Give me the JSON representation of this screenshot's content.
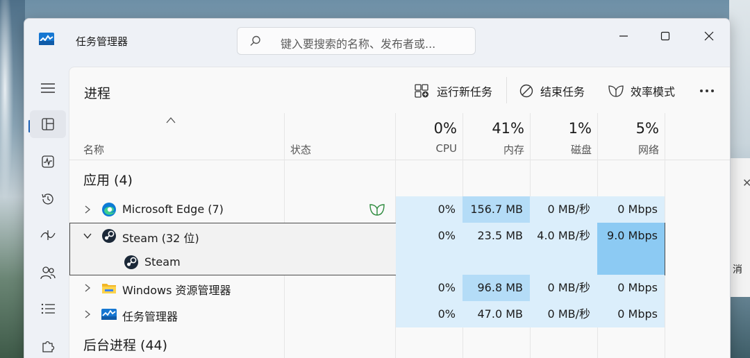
{
  "window": {
    "title": "任务管理器",
    "search_placeholder": "键入要搜索的名称、发布者或..."
  },
  "page": {
    "title": "进程",
    "commands": {
      "run_new_task": "运行新任务",
      "end_task": "结束任务",
      "efficiency_mode": "效率模式"
    }
  },
  "columns": {
    "name": "名称",
    "status": "状态",
    "cpu": {
      "pct": "0%",
      "label": "CPU"
    },
    "memory": {
      "pct": "41%",
      "label": "内存"
    },
    "disk": {
      "pct": "1%",
      "label": "磁盘"
    },
    "network": {
      "pct": "5%",
      "label": "网络"
    }
  },
  "groups": {
    "apps": "应用 (4)",
    "background": "后台进程 (44)"
  },
  "rows": [
    {
      "name": "Microsoft Edge (7)",
      "cpu": "0%",
      "memory": "156.7 MB",
      "disk": "0 MB/秒",
      "network": "0 Mbps"
    },
    {
      "name": "Steam (32 位)",
      "cpu": "0%",
      "memory": "23.5 MB",
      "disk": "4.0 MB/秒",
      "network": "9.0 Mbps"
    },
    {
      "name": "Steam"
    },
    {
      "name": "Windows 资源管理器",
      "cpu": "0%",
      "memory": "96.8 MB",
      "disk": "0 MB/秒",
      "network": "0 Mbps"
    },
    {
      "name": "任务管理器",
      "cpu": "0%",
      "memory": "47.0 MB",
      "disk": "0 MB/秒",
      "network": "0 Mbps"
    }
  ],
  "background_window": {
    "text": "消"
  },
  "colors": {
    "accent": "#1a5fb4",
    "heat_low": "#dbeefb",
    "heat_mid": "#b4dcf7",
    "heat_high": "#8ccaf3"
  }
}
